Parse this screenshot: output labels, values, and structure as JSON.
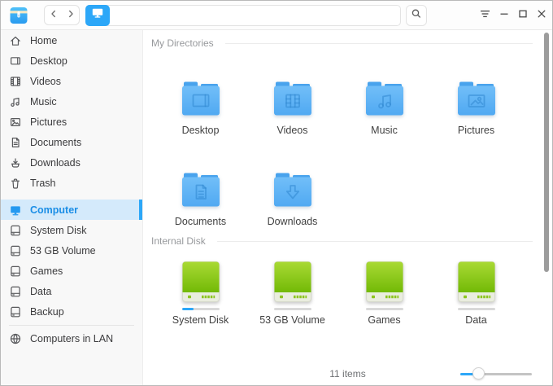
{
  "colors": {
    "accent": "#2CA7F8",
    "folder_top": "#71BEF8",
    "folder_bottom": "#50A9F2",
    "folder_tab": "#49A3ED",
    "disk_top": "#A9D934",
    "disk_bottom": "#72B906",
    "selected_bg": "#D4EAFB"
  },
  "titlebar": {
    "app_icon": "file-manager-app-icon",
    "back_icon": "chevron-left-icon",
    "forward_icon": "chevron-right-icon",
    "crumb_icon": "computer-crumb-icon",
    "search_icon": "search-icon",
    "menu_icon": "hamburger-menu-icon",
    "minimize_icon": "minimize-icon",
    "maximize_icon": "maximize-icon",
    "close_icon": "close-icon"
  },
  "sidebar": {
    "groups": [
      {
        "items": [
          {
            "id": "home",
            "label": "Home",
            "icon": "home-icon"
          },
          {
            "id": "desktop",
            "label": "Desktop",
            "icon": "desktop-icon"
          },
          {
            "id": "videos",
            "label": "Videos",
            "icon": "videos-icon"
          },
          {
            "id": "music",
            "label": "Music",
            "icon": "music-icon"
          },
          {
            "id": "pictures",
            "label": "Pictures",
            "icon": "pictures-icon"
          },
          {
            "id": "documents",
            "label": "Documents",
            "icon": "documents-icon"
          },
          {
            "id": "downloads",
            "label": "Downloads",
            "icon": "downloads-icon"
          },
          {
            "id": "trash",
            "label": "Trash",
            "icon": "trash-icon"
          }
        ]
      },
      {
        "items": [
          {
            "id": "computer",
            "label": "Computer",
            "icon": "computer-icon",
            "selected": true
          },
          {
            "id": "system-disk",
            "label": "System Disk",
            "icon": "drive-icon"
          },
          {
            "id": "volume-53gb",
            "label": "53 GB Volume",
            "icon": "drive-icon"
          },
          {
            "id": "games",
            "label": "Games",
            "icon": "drive-icon"
          },
          {
            "id": "data",
            "label": "Data",
            "icon": "drive-icon"
          },
          {
            "id": "backup",
            "label": "Backup",
            "icon": "drive-icon"
          }
        ]
      },
      {
        "separator_before": true,
        "items": [
          {
            "id": "computers-in-lan",
            "label": "Computers in LAN",
            "icon": "network-icon"
          }
        ]
      }
    ]
  },
  "main": {
    "sections": [
      {
        "title": "My Directories",
        "type": "folders",
        "items": [
          {
            "label": "Desktop",
            "emblem": "desktop"
          },
          {
            "label": "Videos",
            "emblem": "videos"
          },
          {
            "label": "Music",
            "emblem": "music"
          },
          {
            "label": "Pictures",
            "emblem": "pictures"
          },
          {
            "label": "Documents",
            "emblem": "documents"
          },
          {
            "label": "Downloads",
            "emblem": "downloads"
          }
        ]
      },
      {
        "title": "Internal Disk",
        "type": "disks",
        "items": [
          {
            "label": "System Disk",
            "usage": 0.32
          },
          {
            "label": "53 GB Volume",
            "usage": 0
          },
          {
            "label": "Games",
            "usage": 0
          },
          {
            "label": "Data",
            "usage": 0
          }
        ]
      }
    ],
    "status": {
      "count_text": "11 items",
      "slider_position": 0.26
    }
  }
}
